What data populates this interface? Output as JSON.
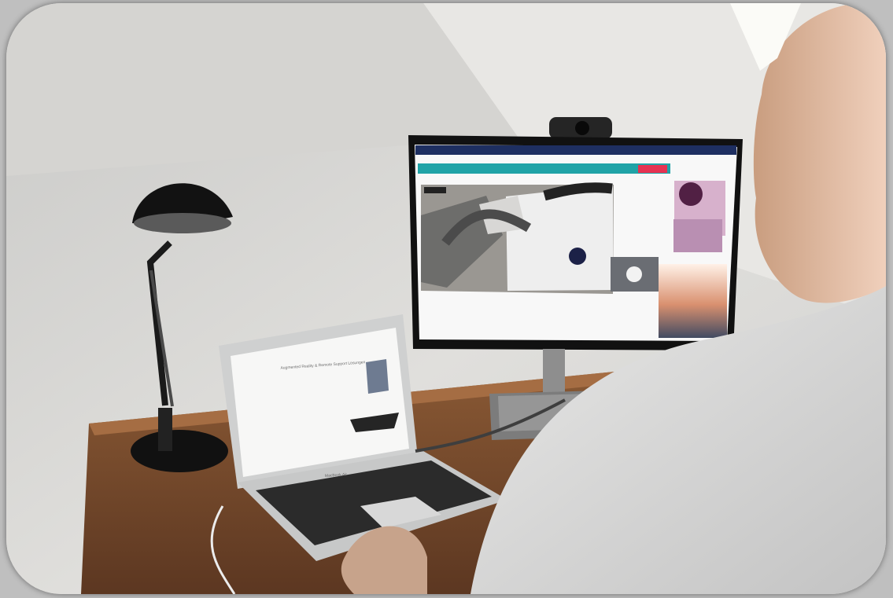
{
  "scene": {
    "laptop_screen_heading": "Augmented Reality & Remote Support Lösungen",
    "laptop_brand": "MacBook Air"
  }
}
